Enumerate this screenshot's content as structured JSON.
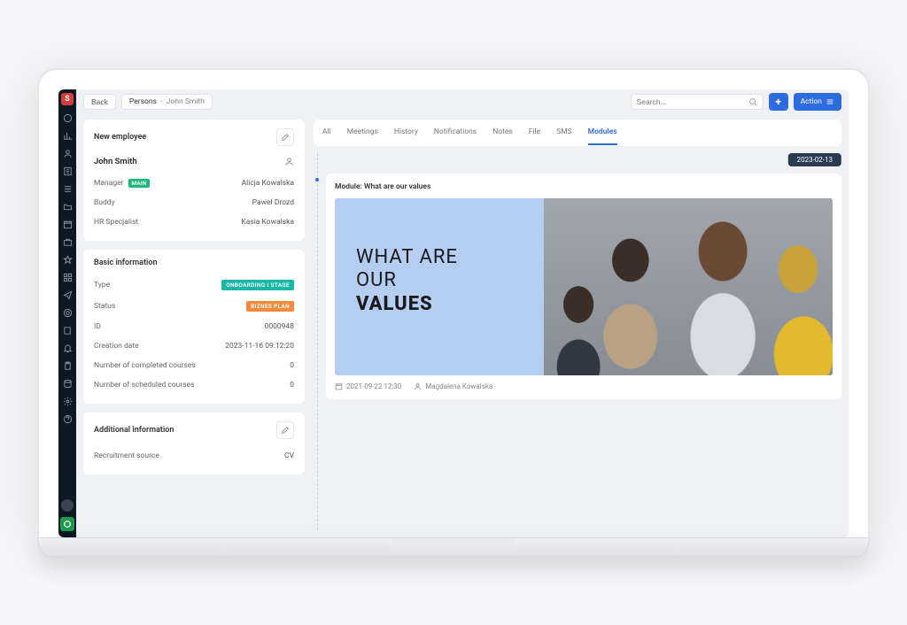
{
  "topbar": {
    "back": "Back",
    "crumb_root": "Persons",
    "crumb_current": "John Smith",
    "search_placeholder": "Search...",
    "action_label": "Action"
  },
  "employee_panel": {
    "heading": "New employee",
    "name": "John Smith",
    "rows": {
      "manager_label": "Manager",
      "manager_badge": "MAIN",
      "manager_value": "Alicja Kowalska",
      "buddy_label": "Buddy",
      "buddy_value": "Paweł Drozd",
      "hr_label": "HR Specjalist",
      "hr_value": "Kasia Kowalska"
    }
  },
  "basic_panel": {
    "heading": "Basic information",
    "type_label": "Type",
    "type_badge": "ONBOARDING I STAGE",
    "status_label": "Status",
    "status_badge": "BIZNES PLAN",
    "id_label": "ID",
    "id_value": "0000948",
    "created_label": "Creation date",
    "created_value": "2023-11-16 09:12:20",
    "completed_label": "Number of completed courses",
    "completed_value": "0",
    "scheduled_label": "Number of scheduled courses",
    "scheduled_value": "0"
  },
  "additional_panel": {
    "heading": "Additional information",
    "source_label": "Recruitment source",
    "source_value": "CV"
  },
  "tabs": {
    "all": "All",
    "meetings": "Meetings",
    "history": "History",
    "notifications": "Notifications",
    "notes": "Notes",
    "file": "File",
    "sms": "SMS",
    "modules": "Modules"
  },
  "timeline": {
    "date": "2023-02-13",
    "module_title": "Module: What are our values",
    "hero_line1": "WHAT ARE",
    "hero_line2": "OUR",
    "hero_line3": "VALUES",
    "meta_date": "2021-09-22  12:30",
    "meta_author": "Magdalena Kowalska"
  }
}
